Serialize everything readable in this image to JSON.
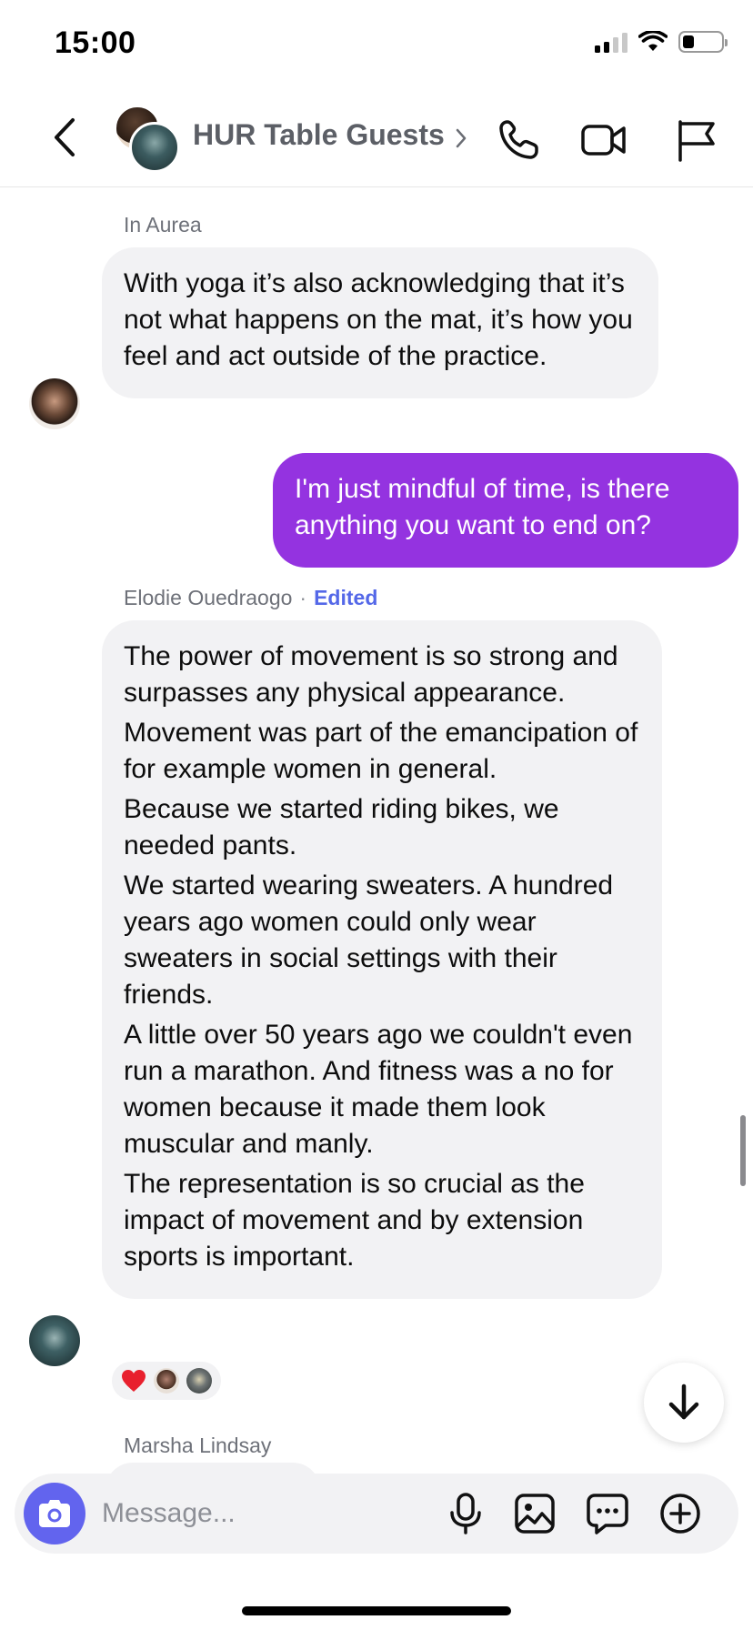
{
  "status_bar": {
    "time": "15:00",
    "icons": [
      "cellular-signal-icon",
      "wifi-icon",
      "battery-icon"
    ],
    "battery_level": 0.3
  },
  "header": {
    "title": "HUR Table Guests",
    "icons": [
      "back-icon",
      "chevron-right-icon",
      "phone-icon",
      "video-camera-icon",
      "flag-icon"
    ]
  },
  "messages": [
    {
      "sender": "In Aurea",
      "direction": "incoming",
      "paragraphs": [
        "With yoga it’s also acknowledging that it’s not what happens on the mat, it’s how you feel and act outside of the practice."
      ]
    },
    {
      "direction": "outgoing",
      "paragraphs": [
        "I'm just mindful of time, is there anything you want to end on?"
      ]
    },
    {
      "sender": "Elodie Ouedraogo",
      "separator": "·",
      "edited_label": "Edited",
      "direction": "incoming",
      "paragraphs": [
        "The power of movement is so strong and surpasses any physical appearance.",
        "Movement was part of the emancipation of for example women in general.",
        "Because we started riding bikes, we needed pants.",
        "We started wearing sweaters. A hundred years ago women could only wear sweaters in social settings with their friends.",
        "A little over 50 years ago we couldn't even run a marathon. And fitness was a no for women because it made them look muscular and manly.",
        "The representation is so crucial as the impact of movement and by extension sports is important."
      ],
      "reactions": [
        "heart-emoji",
        "reactor-avatar",
        "reactor-avatar"
      ]
    },
    {
      "sender": "Marsha Lindsay",
      "direction": "incoming"
    }
  ],
  "composer": {
    "placeholder": "Message...",
    "icons": [
      "camera-icon",
      "microphone-icon",
      "gallery-icon",
      "chat-bubble-icon",
      "plus-circle-icon"
    ]
  },
  "colors": {
    "outgoing_bubble": "#9433e0",
    "incoming_bubble": "#f2f2f4",
    "accent": "#6264ee",
    "edited_label": "#5468e8"
  }
}
